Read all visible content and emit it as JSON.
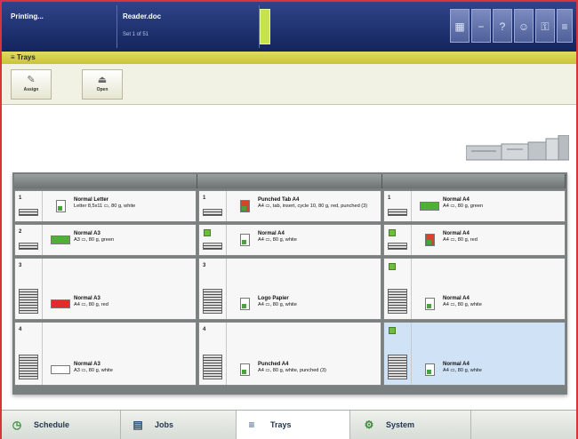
{
  "header": {
    "status": "Printing...",
    "document": "Reader.doc",
    "set_info": "Set 1 of 51"
  },
  "section_title": "Trays",
  "toolbar": {
    "assign": "Assign",
    "open": "Open"
  },
  "trays": [
    {
      "id": "c1r1",
      "number": "1",
      "name": "Normal Letter",
      "details": "Letter 8,5x11 ▭, 80 g, white",
      "swatch": "paper-icon"
    },
    {
      "id": "c2r1",
      "number": "1",
      "name": "Punched Tab A4",
      "details": "A4 ▭, tab, insert, cycle 10, 80 g, red, punched (3)",
      "swatch": "tab-paper-icon"
    },
    {
      "id": "c3r1",
      "number": "1",
      "name": "Normal A4",
      "details": "A4 ▭, 80 g, green",
      "swatch": "#4fb038"
    },
    {
      "id": "c1r2",
      "number": "2",
      "name": "Normal A3",
      "details": "A3 ▭, 80 g, green",
      "swatch": "#4fb038"
    },
    {
      "id": "c2r2",
      "number": "2",
      "name": "Normal A4",
      "details": "A4 ▭, 80 g, white",
      "swatch": "paper-icon"
    },
    {
      "id": "c3r2",
      "number": "2",
      "name": "Normal A4",
      "details": "A4 ▭, 80 g, red",
      "swatch": "red-paper-icon"
    },
    {
      "id": "c1r3",
      "number": "3",
      "name": "Normal A3",
      "details": "A4 ▭, 80 g, red",
      "swatch": "#e52b25"
    },
    {
      "id": "c2r3",
      "number": "3",
      "name": "Logo Papier",
      "details": "A4 ▭, 80 g, white",
      "swatch": "paper-icon"
    },
    {
      "id": "c3r3",
      "number": "3",
      "name": "Normal A4",
      "details": "A4 ▭, 80 g, white",
      "swatch": "paper-icon"
    },
    {
      "id": "c1r4",
      "number": "4",
      "name": "Normal A3",
      "details": "A3 ▭, 80 g, white",
      "swatch": "#ffffff"
    },
    {
      "id": "c2r4",
      "number": "4",
      "name": "Punched A4",
      "details": "A4 ▭, 80 g, white, punched (3)",
      "swatch": "paper-icon"
    },
    {
      "id": "c3r4",
      "number": "4",
      "name": "Normal A4",
      "details": "A4 ▭, 80 g, white",
      "swatch": "paper-icon"
    }
  ],
  "tabs": {
    "schedule": "Schedule",
    "jobs": "Jobs",
    "trays": "Trays",
    "system": "System"
  },
  "colors": {
    "accent_header": "#cfc646",
    "navy": "#1d2e6c",
    "selected_tray": "#cfe2f6"
  }
}
